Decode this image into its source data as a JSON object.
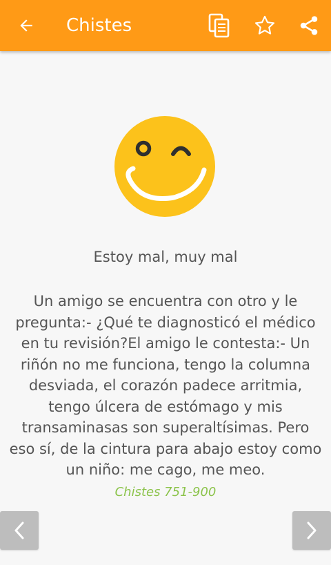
{
  "app_bar": {
    "title": "Chistes",
    "back_icon": "arrow-left-icon",
    "actions": [
      "copy-icon",
      "star-outline-icon",
      "share-icon"
    ],
    "background": "#ff9a16"
  },
  "joke": {
    "icon": "winking-smiley-icon",
    "title": "Estoy mal, muy mal",
    "body": "Un amigo se encuentra con otro y le pregunta:- ¿Qué te diagnosticó el médico en tu revisión?El amigo le contesta:- Un riñón no me funciona, tengo la columna desviada, el corazón padece arritmia, tengo úlcera de estómago y mis transaminasas son superaltísimas. Pero eso sí, de la cintura para abajo estoy como un niño: me cago, me meo.",
    "source": "Chistes 751-900",
    "source_color": "#8bc34a"
  },
  "navigation": {
    "prev_icon": "chevron-left-icon",
    "next_icon": "chevron-right-icon"
  }
}
